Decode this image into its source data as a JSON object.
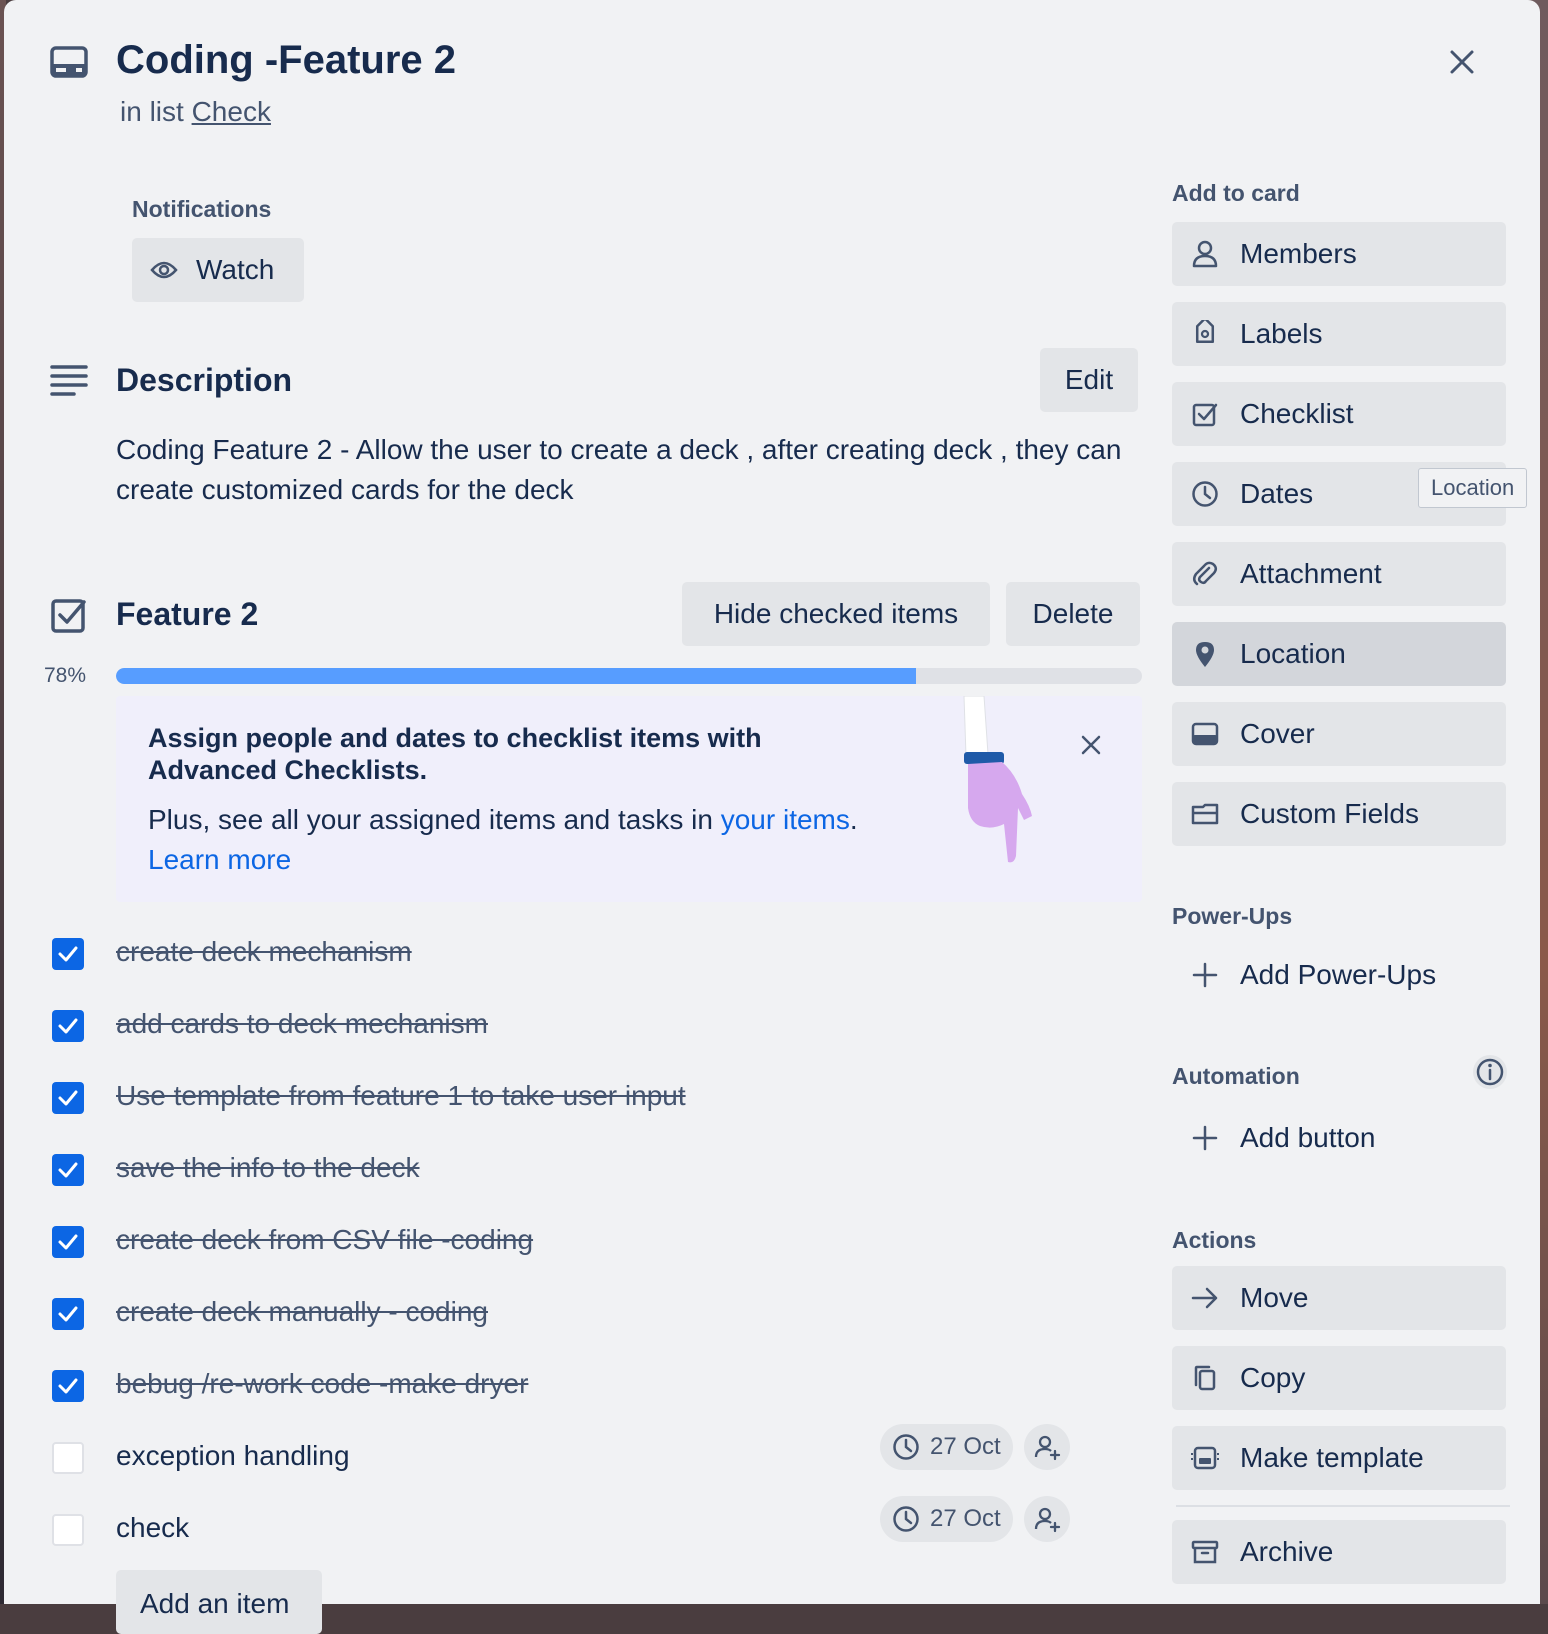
{
  "card": {
    "title": "Coding -Feature 2",
    "in_list_prefix": "in list",
    "list_name": "Check"
  },
  "notifications": {
    "label": "Notifications",
    "watch_label": "Watch"
  },
  "description": {
    "heading": "Description",
    "edit_label": "Edit",
    "text": "Coding Feature 2 - Allow the user to create a deck , after creating deck , they can create customized cards for the deck"
  },
  "checklist": {
    "title": "Feature 2",
    "hide_label": "Hide checked items",
    "delete_label": "Delete",
    "progress_text": "78%",
    "progress": 0.78,
    "items": [
      {
        "text": "create deck mechanism",
        "checked": true
      },
      {
        "text": "add cards to deck mechanism",
        "checked": true
      },
      {
        "text": "Use template from feature 1 to take user input",
        "checked": true
      },
      {
        "text": "save the info to the deck",
        "checked": true
      },
      {
        "text": "create deck from CSV file -coding",
        "checked": true
      },
      {
        "text": "create deck manually - coding",
        "checked": true
      },
      {
        "text": "bebug /re-work code -make dryer",
        "checked": true
      },
      {
        "text": "exception handling",
        "checked": false,
        "due": "27 Oct"
      },
      {
        "text": "check",
        "checked": false,
        "due": "27 Oct"
      }
    ],
    "add_item_label": "Add an item"
  },
  "promo": {
    "title": "Assign people and dates to checklist items with Advanced Checklists.",
    "text_prefix": "Plus, see all your assigned items and tasks in",
    "link_your_items": "your items",
    "text_suffix": ".",
    "learn_more": "Learn more"
  },
  "sidebar": {
    "add_to_card_label": "Add to card",
    "add_to_card": [
      {
        "label": "Members",
        "icon": "person-icon"
      },
      {
        "label": "Labels",
        "icon": "tag-icon"
      },
      {
        "label": "Checklist",
        "icon": "checkbox-icon"
      },
      {
        "label": "Dates",
        "icon": "clock-icon"
      },
      {
        "label": "Attachment",
        "icon": "paperclip-icon"
      },
      {
        "label": "Location",
        "icon": "map-pin-icon"
      },
      {
        "label": "Cover",
        "icon": "cover-icon"
      },
      {
        "label": "Custom Fields",
        "icon": "custom-fields-icon"
      }
    ],
    "tooltip": "Location",
    "powerups_label": "Power-Ups",
    "add_powerups": "Add Power-Ups",
    "automation_label": "Automation",
    "add_button": "Add button",
    "actions_label": "Actions",
    "actions": [
      {
        "label": "Move",
        "icon": "arrow-right-icon"
      },
      {
        "label": "Copy",
        "icon": "copy-icon"
      },
      {
        "label": "Make template",
        "icon": "template-icon"
      },
      {
        "label": "Archive",
        "icon": "archive-icon"
      }
    ]
  },
  "colors": {
    "accent": "#0c66e4",
    "progress": "#579dff",
    "panel_bg": "#f1f2f4",
    "button_bg": "#e3e5e8"
  }
}
